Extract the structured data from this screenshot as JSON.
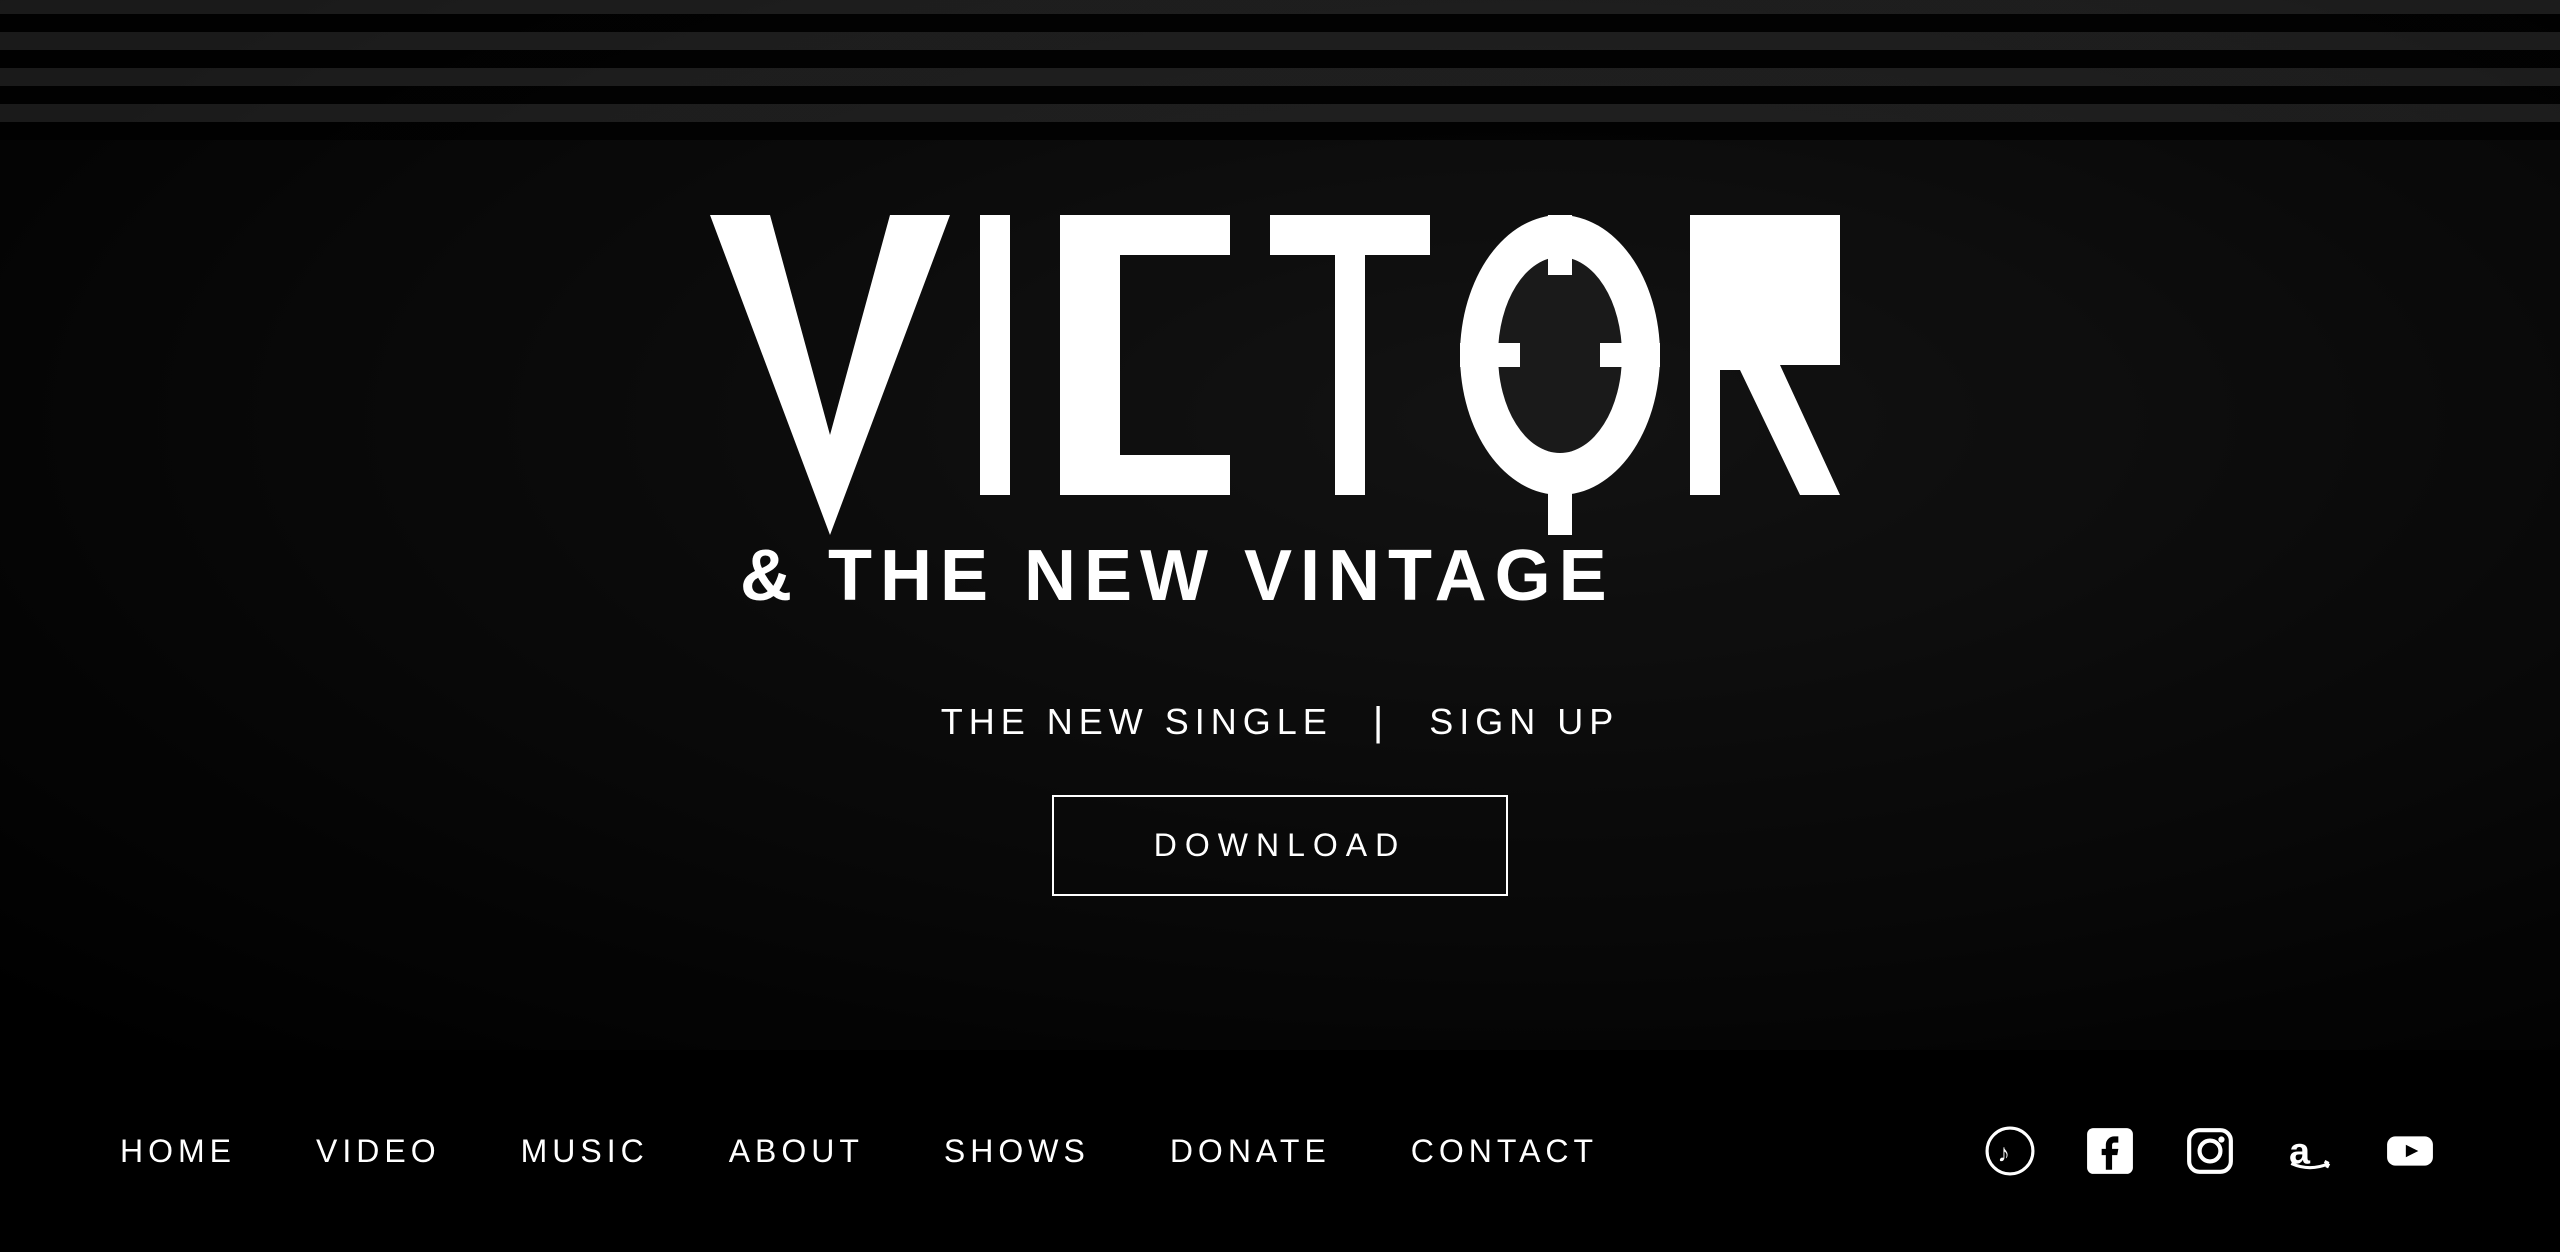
{
  "hero": {
    "band_name_line1": "VICTOR",
    "band_name_line2": "& THE NEW VINTAGE",
    "tagline_single": "THE NEW SINGLE",
    "tagline_divider": "|",
    "tagline_signup": "SIGN UP",
    "download_label": "DOWNLOAD"
  },
  "navbar": {
    "links": [
      {
        "label": "HOME",
        "id": "home"
      },
      {
        "label": "VIDEO",
        "id": "video"
      },
      {
        "label": "MUSIC",
        "id": "music"
      },
      {
        "label": "ABOUT",
        "id": "about"
      },
      {
        "label": "SHOWS",
        "id": "shows"
      },
      {
        "label": "DONATE",
        "id": "donate"
      },
      {
        "label": "CONTACT",
        "id": "contact"
      }
    ]
  },
  "social": {
    "icons": [
      {
        "name": "itunes-icon",
        "label": "iTunes"
      },
      {
        "name": "facebook-icon",
        "label": "Facebook"
      },
      {
        "name": "instagram-icon",
        "label": "Instagram"
      },
      {
        "name": "amazon-icon",
        "label": "Amazon"
      },
      {
        "name": "youtube-icon",
        "label": "YouTube"
      }
    ]
  },
  "colors": {
    "background": "#000000",
    "hero_bg": "#1a1a1a",
    "text_primary": "#ffffff",
    "nav_bg": "#000000"
  }
}
